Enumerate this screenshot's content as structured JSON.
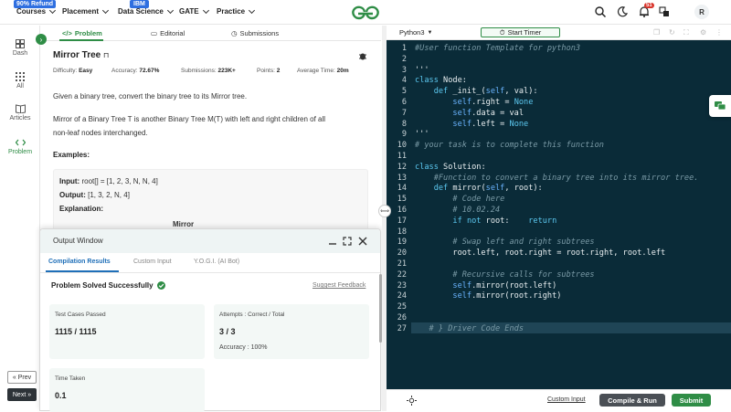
{
  "nav": {
    "refund_badge": "90% Refund",
    "ibm_badge": "IBM",
    "items": [
      "Courses",
      "Placement",
      "Data Science",
      "GATE",
      "Practice"
    ],
    "notification_count": "51",
    "avatar_letter": "R"
  },
  "rail": {
    "items": [
      {
        "label": "Dash",
        "icon": "grid-icon"
      },
      {
        "label": "All",
        "icon": "apps-icon"
      },
      {
        "label": "Articles",
        "icon": "book-icon"
      },
      {
        "label": "Problem",
        "icon": "code-icon"
      }
    ],
    "prev": "Prev",
    "next": "Next"
  },
  "problem": {
    "tabs": [
      "Problem",
      "Editorial",
      "Submissions"
    ],
    "title": "Mirror Tree",
    "meta": {
      "difficulty_label": "Difficulty:",
      "difficulty": "Easy",
      "accuracy_label": "Accuracy:",
      "accuracy": "72.67%",
      "submissions_label": "Submissions:",
      "submissions": "223K+",
      "points_label": "Points:",
      "points": "2",
      "avg_time_label": "Average Time:",
      "avg_time": "20m"
    },
    "desc1": "Given a binary tree, convert the binary tree to its Mirror tree.",
    "desc2a": "Mirror of a Binary Tree T is another Binary Tree M(T) with left and right children of all",
    "desc2b": "non-leaf nodes interchanged.",
    "examples_heading": "Examples:",
    "example": {
      "input_label": "Input:",
      "input": "root[] = [1, 2, 3, N, N, 4]",
      "output_label": "Output:",
      "output": "[1, 3, 2, N, 4]",
      "explanation_label": "Explanation:",
      "partial_heading": "Mirror"
    }
  },
  "output": {
    "title": "Output Window",
    "tabs": [
      "Compilation Results",
      "Custom Input",
      "Y.O.G.I. (AI Bot)"
    ],
    "status": "Problem Solved Successfully",
    "suggest": "Suggest Feedback",
    "cards": {
      "tests_label": "Test Cases Passed",
      "tests_value": "1115 / 1115",
      "attempts_label": "Attempts : Correct / Total",
      "attempts_value": "3 / 3",
      "accuracy_text": "Accuracy : 100%",
      "time_label": "Time Taken",
      "time_value": "0.1"
    }
  },
  "editor": {
    "language": "Python3",
    "timer": "Start Timer",
    "line_numbers": [
      "1",
      "2",
      "3",
      "4",
      "5",
      "6",
      "7",
      "8",
      "9",
      "10",
      "11",
      "12",
      "13",
      "14",
      "15",
      "16",
      "17",
      "18",
      "19",
      "20",
      "21",
      "22",
      "23",
      "24",
      "25",
      "26",
      "27"
    ],
    "lines": [
      "#User function Template for python3",
      "",
      "'''",
      "class Node:",
      "    def _init_(self, val):",
      "        self.right = None",
      "        self.data = val",
      "        self.left = None",
      "'''",
      "# your task is to complete this function",
      "",
      "class Solution:",
      "    #Function to convert a binary tree into its mirror tree.",
      "    def mirror(self, root):",
      "        # Code here",
      "        # 10.02.24",
      "        if not root:    return",
      "",
      "        # Swap left and right subtrees",
      "        root.left, root.right = root.right, root.left",
      "",
      "        # Recursive calls for subtrees",
      "        self.mirror(root.left)",
      "        self.mirror(root.right)",
      "",
      "",
      "   # } Driver Code Ends"
    ],
    "custom_input": "Custom Input",
    "compile": "Compile & Run",
    "submit": "Submit"
  },
  "colors": {
    "brand_green": "#2f8d46",
    "editor_bg": "#0a2b38",
    "code_keyword": "#5cc8f0",
    "code_comment": "#7a9aa6",
    "code_text": "#e8eef0",
    "code_blue": "#6ab4ff"
  }
}
